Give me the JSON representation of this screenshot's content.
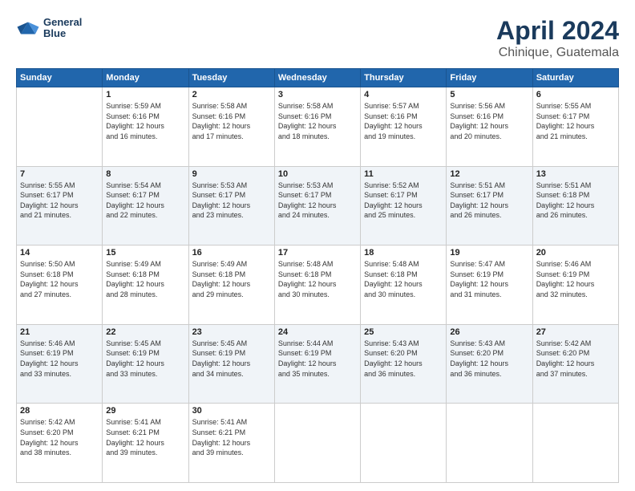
{
  "logo": {
    "line1": "General",
    "line2": "Blue"
  },
  "title": "April 2024",
  "subtitle": "Chinique, Guatemala",
  "columns": [
    "Sunday",
    "Monday",
    "Tuesday",
    "Wednesday",
    "Thursday",
    "Friday",
    "Saturday"
  ],
  "weeks": [
    [
      {
        "day": "",
        "info": ""
      },
      {
        "day": "1",
        "info": "Sunrise: 5:59 AM\nSunset: 6:16 PM\nDaylight: 12 hours\nand 16 minutes."
      },
      {
        "day": "2",
        "info": "Sunrise: 5:58 AM\nSunset: 6:16 PM\nDaylight: 12 hours\nand 17 minutes."
      },
      {
        "day": "3",
        "info": "Sunrise: 5:58 AM\nSunset: 6:16 PM\nDaylight: 12 hours\nand 18 minutes."
      },
      {
        "day": "4",
        "info": "Sunrise: 5:57 AM\nSunset: 6:16 PM\nDaylight: 12 hours\nand 19 minutes."
      },
      {
        "day": "5",
        "info": "Sunrise: 5:56 AM\nSunset: 6:16 PM\nDaylight: 12 hours\nand 20 minutes."
      },
      {
        "day": "6",
        "info": "Sunrise: 5:55 AM\nSunset: 6:17 PM\nDaylight: 12 hours\nand 21 minutes."
      }
    ],
    [
      {
        "day": "7",
        "info": "Sunrise: 5:55 AM\nSunset: 6:17 PM\nDaylight: 12 hours\nand 21 minutes."
      },
      {
        "day": "8",
        "info": "Sunrise: 5:54 AM\nSunset: 6:17 PM\nDaylight: 12 hours\nand 22 minutes."
      },
      {
        "day": "9",
        "info": "Sunrise: 5:53 AM\nSunset: 6:17 PM\nDaylight: 12 hours\nand 23 minutes."
      },
      {
        "day": "10",
        "info": "Sunrise: 5:53 AM\nSunset: 6:17 PM\nDaylight: 12 hours\nand 24 minutes."
      },
      {
        "day": "11",
        "info": "Sunrise: 5:52 AM\nSunset: 6:17 PM\nDaylight: 12 hours\nand 25 minutes."
      },
      {
        "day": "12",
        "info": "Sunrise: 5:51 AM\nSunset: 6:17 PM\nDaylight: 12 hours\nand 26 minutes."
      },
      {
        "day": "13",
        "info": "Sunrise: 5:51 AM\nSunset: 6:18 PM\nDaylight: 12 hours\nand 26 minutes."
      }
    ],
    [
      {
        "day": "14",
        "info": "Sunrise: 5:50 AM\nSunset: 6:18 PM\nDaylight: 12 hours\nand 27 minutes."
      },
      {
        "day": "15",
        "info": "Sunrise: 5:49 AM\nSunset: 6:18 PM\nDaylight: 12 hours\nand 28 minutes."
      },
      {
        "day": "16",
        "info": "Sunrise: 5:49 AM\nSunset: 6:18 PM\nDaylight: 12 hours\nand 29 minutes."
      },
      {
        "day": "17",
        "info": "Sunrise: 5:48 AM\nSunset: 6:18 PM\nDaylight: 12 hours\nand 30 minutes."
      },
      {
        "day": "18",
        "info": "Sunrise: 5:48 AM\nSunset: 6:18 PM\nDaylight: 12 hours\nand 30 minutes."
      },
      {
        "day": "19",
        "info": "Sunrise: 5:47 AM\nSunset: 6:19 PM\nDaylight: 12 hours\nand 31 minutes."
      },
      {
        "day": "20",
        "info": "Sunrise: 5:46 AM\nSunset: 6:19 PM\nDaylight: 12 hours\nand 32 minutes."
      }
    ],
    [
      {
        "day": "21",
        "info": "Sunrise: 5:46 AM\nSunset: 6:19 PM\nDaylight: 12 hours\nand 33 minutes."
      },
      {
        "day": "22",
        "info": "Sunrise: 5:45 AM\nSunset: 6:19 PM\nDaylight: 12 hours\nand 33 minutes."
      },
      {
        "day": "23",
        "info": "Sunrise: 5:45 AM\nSunset: 6:19 PM\nDaylight: 12 hours\nand 34 minutes."
      },
      {
        "day": "24",
        "info": "Sunrise: 5:44 AM\nSunset: 6:19 PM\nDaylight: 12 hours\nand 35 minutes."
      },
      {
        "day": "25",
        "info": "Sunrise: 5:43 AM\nSunset: 6:20 PM\nDaylight: 12 hours\nand 36 minutes."
      },
      {
        "day": "26",
        "info": "Sunrise: 5:43 AM\nSunset: 6:20 PM\nDaylight: 12 hours\nand 36 minutes."
      },
      {
        "day": "27",
        "info": "Sunrise: 5:42 AM\nSunset: 6:20 PM\nDaylight: 12 hours\nand 37 minutes."
      }
    ],
    [
      {
        "day": "28",
        "info": "Sunrise: 5:42 AM\nSunset: 6:20 PM\nDaylight: 12 hours\nand 38 minutes."
      },
      {
        "day": "29",
        "info": "Sunrise: 5:41 AM\nSunset: 6:21 PM\nDaylight: 12 hours\nand 39 minutes."
      },
      {
        "day": "30",
        "info": "Sunrise: 5:41 AM\nSunset: 6:21 PM\nDaylight: 12 hours\nand 39 minutes."
      },
      {
        "day": "",
        "info": ""
      },
      {
        "day": "",
        "info": ""
      },
      {
        "day": "",
        "info": ""
      },
      {
        "day": "",
        "info": ""
      }
    ]
  ]
}
